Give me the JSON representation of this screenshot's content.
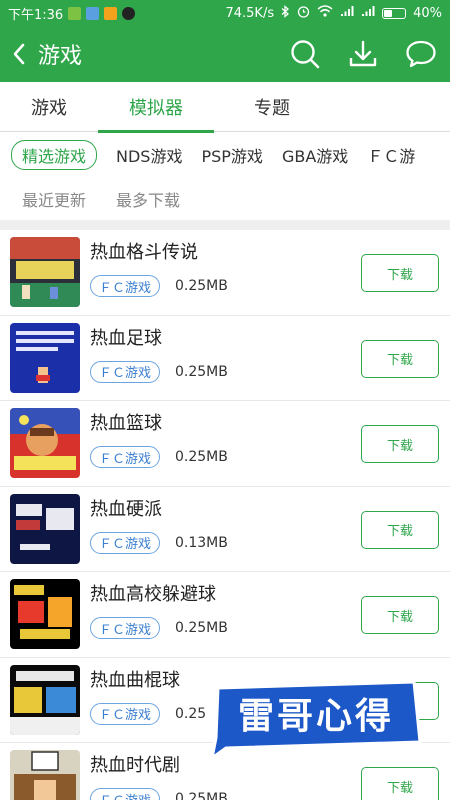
{
  "status": {
    "time": "下午1:36",
    "speed": "74.5K/s",
    "battery": "40%"
  },
  "header": {
    "title": "游戏"
  },
  "tabs": [
    {
      "label": "游戏"
    },
    {
      "label": "模拟器"
    },
    {
      "label": "专题"
    }
  ],
  "categories": [
    "精选游戏",
    "NDS游戏",
    "PSP游戏",
    "GBA游戏",
    "ＦＣ游"
  ],
  "sorts": [
    "最近更新",
    "最多下载"
  ],
  "download_label": "下载",
  "games": [
    {
      "name": "热血格斗传说",
      "tag": "ＦＣ游戏",
      "size": "0.25MB"
    },
    {
      "name": "热血足球",
      "tag": "ＦＣ游戏",
      "size": "0.25MB"
    },
    {
      "name": "热血篮球",
      "tag": "ＦＣ游戏",
      "size": "0.25MB"
    },
    {
      "name": "热血硬派",
      "tag": "ＦＣ游戏",
      "size": "0.13MB"
    },
    {
      "name": "热血高校躲避球",
      "tag": "ＦＣ游戏",
      "size": "0.25MB"
    },
    {
      "name": "热血曲棍球",
      "tag": "ＦＣ游戏",
      "size": "0.25"
    },
    {
      "name": "热血时代剧",
      "tag": "ＦＣ游戏",
      "size": "0.25MB"
    }
  ],
  "watermark": {
    "text": "雷哥心得"
  },
  "colors": {
    "accent": "#2fa64a",
    "tag": "#3a7fd0",
    "watermark_bg": "#1c58c8"
  }
}
